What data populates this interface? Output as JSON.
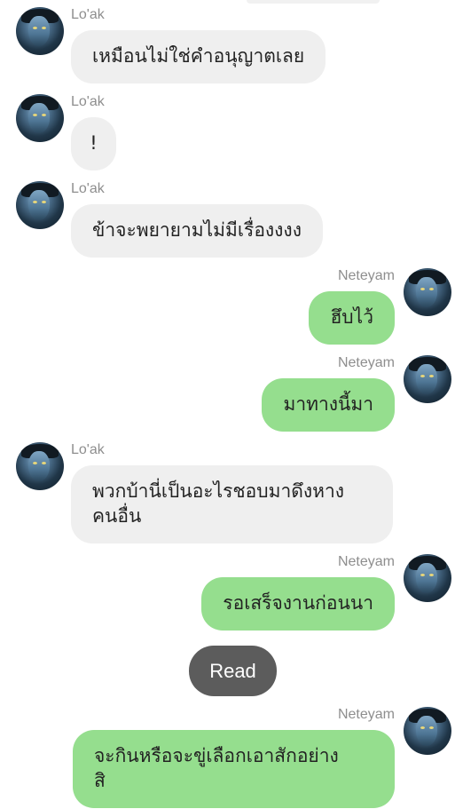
{
  "messages": [
    {
      "sender": "Lo'ak",
      "side": "left",
      "text": "เหมือนไม่ใช่คำอนุญาตเลย"
    },
    {
      "sender": "Lo'ak",
      "side": "left",
      "text": "!"
    },
    {
      "sender": "Lo'ak",
      "side": "left",
      "text": "ข้าจะพยายามไม่มีเรื่องงงง"
    },
    {
      "sender": "Neteyam",
      "side": "right",
      "text": "ฮึบไว้"
    },
    {
      "sender": "Neteyam",
      "side": "right",
      "text": "มาทางนี้มา"
    },
    {
      "sender": "Lo'ak",
      "side": "left",
      "text": "พวกบ้านี่เป็นอะไรชอบมาดึงหาง\nคนอื่น"
    },
    {
      "sender": "Neteyam",
      "side": "right",
      "text": "รอเสร็จงานก่อนนา"
    },
    {
      "sender": "Neteyam",
      "side": "right",
      "text": "จะกินหรือจะขู่เลือกเอาสักอย่าง\nสิ"
    }
  ],
  "read_status": "Read",
  "colors": {
    "incoming_bubble": "#efefef",
    "outgoing_bubble": "#95de8e",
    "read_badge": "#5c5c5c",
    "sender_name": "#8e8e8e"
  }
}
